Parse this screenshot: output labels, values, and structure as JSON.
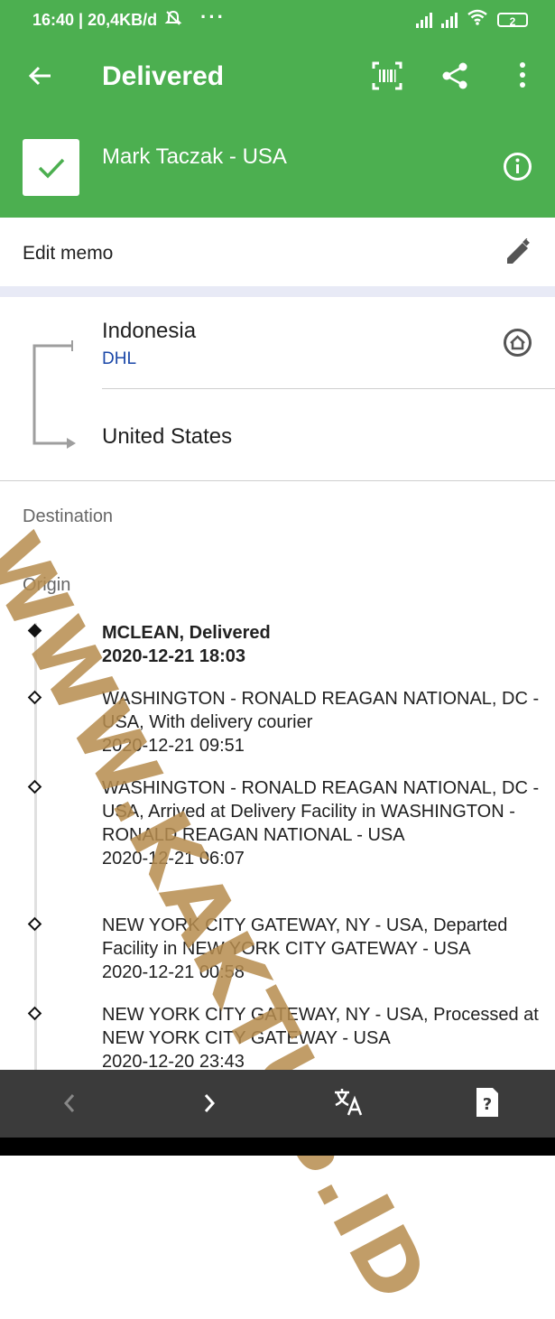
{
  "status_bar": {
    "time_text": "16:40 | 20,4KB/d",
    "more_dots": "···",
    "battery_level": "2"
  },
  "app_bar": {
    "title": "Delivered",
    "recipient": "Mark Taczak - USA",
    "icons": [
      "back-arrow-icon",
      "barcode-icon",
      "share-icon",
      "more-vert-icon",
      "check-icon",
      "info-icon"
    ]
  },
  "memo": {
    "label": "Edit memo",
    "icon": "pencil-icon"
  },
  "route": {
    "origin_country": "Indonesia",
    "carrier": "DHL",
    "destination_country": "United States",
    "icon": "home-icon"
  },
  "sections": {
    "destination_label": "Destination",
    "origin_label": "Origin"
  },
  "timeline": [
    {
      "location": "MCLEAN, Delivered",
      "date": "2020-12-21 18:03",
      "current": true
    },
    {
      "location": "WASHINGTON - RONALD REAGAN NATIONAL, DC - USA, With delivery courier",
      "date": "2020-12-21 09:51",
      "current": false
    },
    {
      "location": "WASHINGTON - RONALD REAGAN NATIONAL, DC - USA, Arrived at Delivery Facility in WASHINGTON - RONALD REAGAN NATIONAL - USA",
      "date": "2020-12-21 06:07",
      "current": false
    },
    {
      "location": "NEW YORK CITY GATEWAY, NY - USA, Departed Facility in NEW YORK CITY GATEWAY - USA",
      "date": "2020-12-21 00:58",
      "current": false
    },
    {
      "location": "NEW YORK CITY GATEWAY, NY - USA, Processed at NEW YORK CITY GATEWAY - USA",
      "date": "2020-12-20 23:43",
      "current": false
    }
  ],
  "watermark": "WWW.KAKTUS.ID",
  "bottom_nav": {
    "icons": [
      "chevron-left-icon",
      "chevron-right-icon",
      "translate-icon",
      "help-icon"
    ]
  },
  "colors": {
    "primary": "#4caf50",
    "carrier_link": "#1a47a8",
    "nav_background": "#3b3b3b",
    "watermark": "#b68c4e"
  }
}
